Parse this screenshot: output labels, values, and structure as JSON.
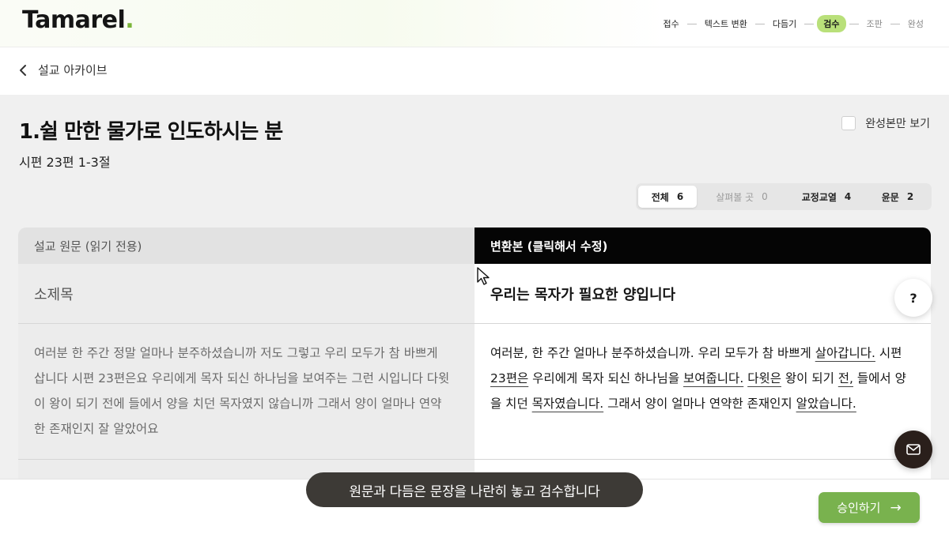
{
  "brand": {
    "name": "Tamarel",
    "dot": "."
  },
  "steps": [
    {
      "label": "접수",
      "state": "done"
    },
    {
      "label": "텍스트 변환",
      "state": "done"
    },
    {
      "label": "다듬기",
      "state": "done"
    },
    {
      "label": "검수",
      "state": "active"
    },
    {
      "label": "조판",
      "state": "todo"
    },
    {
      "label": "완성",
      "state": "todo"
    }
  ],
  "nav": {
    "back_label": "설교 아카이브"
  },
  "sermon": {
    "title": "1.쉴 만한 물가로 인도하시는 분",
    "reference": "시편 23편 1-3절"
  },
  "toggle": {
    "only_done_label": "완성본만 보기",
    "checked": false
  },
  "filters": [
    {
      "label": "전체",
      "count": "6"
    },
    {
      "label": "살펴볼 곳",
      "count": "0"
    },
    {
      "label": "교정교열",
      "count": "4"
    },
    {
      "label": "윤문",
      "count": "2"
    }
  ],
  "table": {
    "left_header": "설교 원문 (읽기 전용)",
    "right_header": "변환본 (클릭해서 수정)",
    "rows": [
      {
        "original": "소제목",
        "converted": "우리는 목자가 필요한 양입니다"
      },
      {
        "original": "여러분 한 주간 정말 얼마나 분주하셨습니까 저도 그렇고 우리 모두가 참 바쁘게 삽니다 시편 23편은요 우리에게 목자 되신 하나님을 보여주는 그런 시입니다 다윗이 왕이 되기 전에 들에서 양을 치던 목자였지 않습니까 그래서 양이 얼마나 연약한 존재인지 잘 알았어요",
        "converted_parts": [
          {
            "text": "여러분, 한 주간 얼마나 분주하셨습니까. 우리 모두가 참 바쁘게 ",
            "edited": false
          },
          {
            "text": "살아갑니다.",
            "edited": true
          },
          {
            "text": " 시편 ",
            "edited": false
          },
          {
            "text": "23편은",
            "edited": true
          },
          {
            "text": " 우리에게 목자 되신 하나님을 ",
            "edited": false
          },
          {
            "text": "보여줍니다.",
            "edited": true
          },
          {
            "text": " ",
            "edited": false
          },
          {
            "text": "다윗은",
            "edited": true
          },
          {
            "text": " 왕이 되기 ",
            "edited": false
          },
          {
            "text": "전,",
            "edited": true
          },
          {
            "text": " 들에서 양을 치던 ",
            "edited": false
          },
          {
            "text": "목자였습니다.",
            "edited": true
          },
          {
            "text": " 그래서 양이 얼마나 연약한 존재인지 ",
            "edited": false
          },
          {
            "text": "알았습니다.",
            "edited": true
          }
        ]
      }
    ]
  },
  "caption": "원문과 다듬은 문장을 나란히 놓고 검수합니다",
  "approve_label": "승인하기",
  "help_label": "?",
  "colors": {
    "accent": "#79b24e",
    "active_step": "#b9e07a",
    "header_dark": "#050505"
  }
}
